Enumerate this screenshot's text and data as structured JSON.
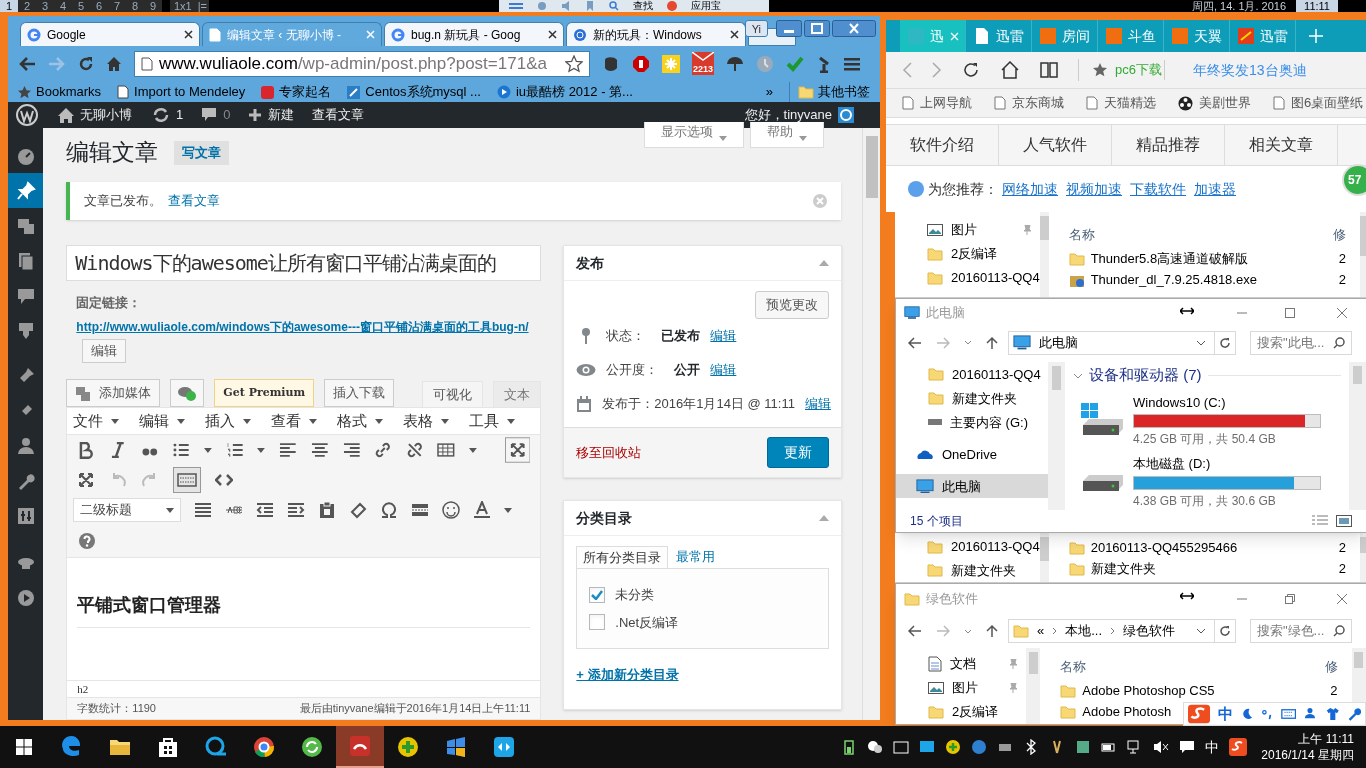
{
  "top_bar": {
    "workspaces": [
      {
        "label": "1",
        "selected": true
      },
      {
        "label": "2",
        "selected": false
      },
      {
        "label": "3",
        "selected": false
      },
      {
        "label": "4",
        "selected": false
      },
      {
        "label": "5",
        "selected": false
      },
      {
        "label": "6",
        "selected": false
      },
      {
        "label": "7",
        "selected": false
      },
      {
        "label": "8",
        "selected": false
      },
      {
        "label": "9",
        "selected": false
      }
    ],
    "layout": "1x1",
    "layout_symbol": "|=",
    "center_items": [
      "查找",
      "应用宝"
    ],
    "date": "周四, 14. 1月. 2016",
    "time": "11:11"
  },
  "chrome": {
    "tabs": [
      {
        "title": "Google",
        "selected": false
      },
      {
        "title": "编辑文章 ‹ 无聊小博 -",
        "selected": true
      },
      {
        "title": "bug.n 新玩具 - Goog",
        "selected": false
      },
      {
        "title": "新的玩具：Windows",
        "selected": false
      }
    ],
    "profile": "Yi",
    "url_host": "www.wuliaole.com",
    "url_path": "/wp-admin/post.php?post=171&a",
    "mail_badge": "2213",
    "bookmarks": [
      "Bookmarks",
      "Import to Mendeley",
      "专家起名",
      "Centos系统mysql ...",
      "iu最酷榜 2012 - 第..."
    ],
    "more": "»",
    "other_bookmarks": "其他书签"
  },
  "wp": {
    "admin_bar": {
      "site": "无聊小博",
      "updates": "1",
      "comments": "0",
      "new": "新建",
      "view": "查看文章",
      "greeting": "您好，tinyvane"
    },
    "admin_menu": [
      {
        "selected": false
      },
      {
        "selected": true
      },
      {
        "selected": false
      },
      {
        "selected": false
      },
      {
        "selected": false
      },
      {
        "selected": false
      },
      {
        "selected": false
      },
      {
        "selected": false
      },
      {
        "selected": false
      },
      {
        "selected": false
      },
      {
        "selected": false
      },
      {
        "selected": false
      },
      {
        "selected": false
      }
    ],
    "screen_tabs": [
      "显示选项",
      "帮助"
    ],
    "heading": "编辑文章",
    "add_new": "写文章",
    "notice": {
      "text": "文章已发布。",
      "link": "查看文章"
    },
    "title_value": "Windows下的awesome让所有窗口平铺沾满桌面的",
    "permalink": {
      "label": "固定链接：",
      "link_text": "http://www.wuliaole.com/windows下的awesome---窗口平铺沾满桌面的工具bug-n/",
      "edit": "编辑"
    },
    "media_buttons": [
      {
        "label": "添加媒体",
        "kind": "media"
      },
      {
        "kind": "icon"
      },
      {
        "label": "Get Premium",
        "kind": "premium"
      },
      {
        "label": "插入下载",
        "kind": "plain"
      }
    ],
    "editor_tabs": [
      {
        "label": "可视化",
        "selected": true
      },
      {
        "label": "文本",
        "selected": false
      }
    ],
    "menubar": [
      "文件",
      "编辑",
      "插入",
      "查看",
      "格式",
      "表格",
      "工具"
    ],
    "format_select": "二级标题",
    "content_heading": "平铺式窗口管理器",
    "path": "h2",
    "word_count": "字数统计：1190",
    "last_edit": "最后由tinyvane编辑于2016年1月14日上午11:11",
    "publish": {
      "title": "发布",
      "preview": "预览更改",
      "rows": [
        {
          "label": "状态：",
          "value": "已发布",
          "link": "编辑"
        },
        {
          "label": "公开度：",
          "value": "公开",
          "link": "编辑"
        },
        {
          "label": "发布于：2016年1月14日 @ 11:11",
          "link": "编辑"
        }
      ],
      "trash": "移至回收站",
      "update": "更新"
    },
    "categories": {
      "title": "分类目录",
      "tabs": [
        {
          "label": "所有分类目录",
          "selected": true
        },
        {
          "label": "最常用",
          "selected": false
        }
      ],
      "items": [
        {
          "label": "未分类",
          "checked": true
        },
        {
          "label": ".Net反编译",
          "checked": false
        }
      ],
      "add": "+ 添加新分类目录"
    }
  },
  "browser2": {
    "tabs": [
      {
        "title": "迅",
        "selected": true
      },
      {
        "title": "迅雷",
        "selected": false
      },
      {
        "title": "房间",
        "selected": false
      },
      {
        "title": "斗鱼",
        "selected": false
      },
      {
        "title": "天翼",
        "selected": false
      },
      {
        "title": "迅雷",
        "selected": false
      }
    ],
    "site": "pc6下载",
    "headline": "年终奖发13台奥迪",
    "bookmarks": [
      "上网导航",
      "京东商城",
      "天猫精选",
      "美剧世界",
      "图6桌面壁纸"
    ],
    "nav": [
      "软件介绍",
      "人气软件",
      "精品推荐",
      "相关文章"
    ],
    "recommend_label": "为您推荐：",
    "recommend_links": [
      "网络加速",
      "视频加速",
      "下载软件",
      "加速器"
    ],
    "badge": "57"
  },
  "explorer_back": {
    "nav_top": [
      "图片",
      "2反编译",
      "20160113-QQ4"
    ],
    "header": "名称",
    "header_2": "修",
    "files_top": [
      {
        "name": "Thunder5.8高速通道破解版",
        "date_modified": "2"
      },
      {
        "name": "Thunder_dl_7.9.25.4818.exe",
        "date_modified": "2"
      }
    ],
    "nav_mid": [
      "20160113-QQ4",
      "新建文件夹"
    ],
    "files_mid": [
      {
        "name": "20160113-QQ455295466",
        "date_modified": "2"
      },
      {
        "name": "新建文件夹",
        "date_modified": "2"
      }
    ]
  },
  "this_pc": {
    "title": "此电脑",
    "address": "此电脑",
    "search": "搜索\"此电...",
    "nav": [
      {
        "label": "20160113-QQ4",
        "selected": false
      },
      {
        "label": "新建文件夹",
        "selected": false
      },
      {
        "label": "主要内容 (G:)",
        "selected": false
      },
      {
        "label": "OneDrive",
        "selected": false
      },
      {
        "label": "此电脑",
        "selected": true
      }
    ],
    "group": "设备和驱动器 (7)",
    "drives": [
      {
        "name": "Windows10 (C:)",
        "level": 0.92,
        "color": "#da2626",
        "info": "4.25 GB 可用，共 50.4 GB"
      },
      {
        "name": "本地磁盘 (D:)",
        "level": 0.86,
        "color": "#26a0da",
        "info": "4.38 GB 可用，共 30.6 GB"
      }
    ],
    "status": "15 个项目"
  },
  "green_soft": {
    "title": "绿色软件",
    "crumbs": [
      "«",
      "本地...",
      "绿色软件"
    ],
    "search": "搜索\"绿色...",
    "nav": [
      "文档",
      "图片",
      "2反编译"
    ],
    "header": "名称",
    "header_2": "修",
    "files": [
      {
        "name": "Adobe Photoshop CS5",
        "date_modified": "2"
      },
      {
        "name": "Adobe Photosh"
      }
    ]
  },
  "ime_bar": {
    "mode": "中"
  },
  "taskbar": {
    "apps": [
      {
        "active": false
      },
      {
        "active": false
      },
      {
        "active": false
      },
      {
        "active": false
      },
      {
        "active": false
      },
      {
        "active": false
      },
      {
        "active": true
      },
      {
        "active": false
      },
      {
        "active": false
      },
      {
        "active": false
      }
    ],
    "ime": "中",
    "time": "上午 11:11",
    "date": "2016/1/14 星期四"
  }
}
